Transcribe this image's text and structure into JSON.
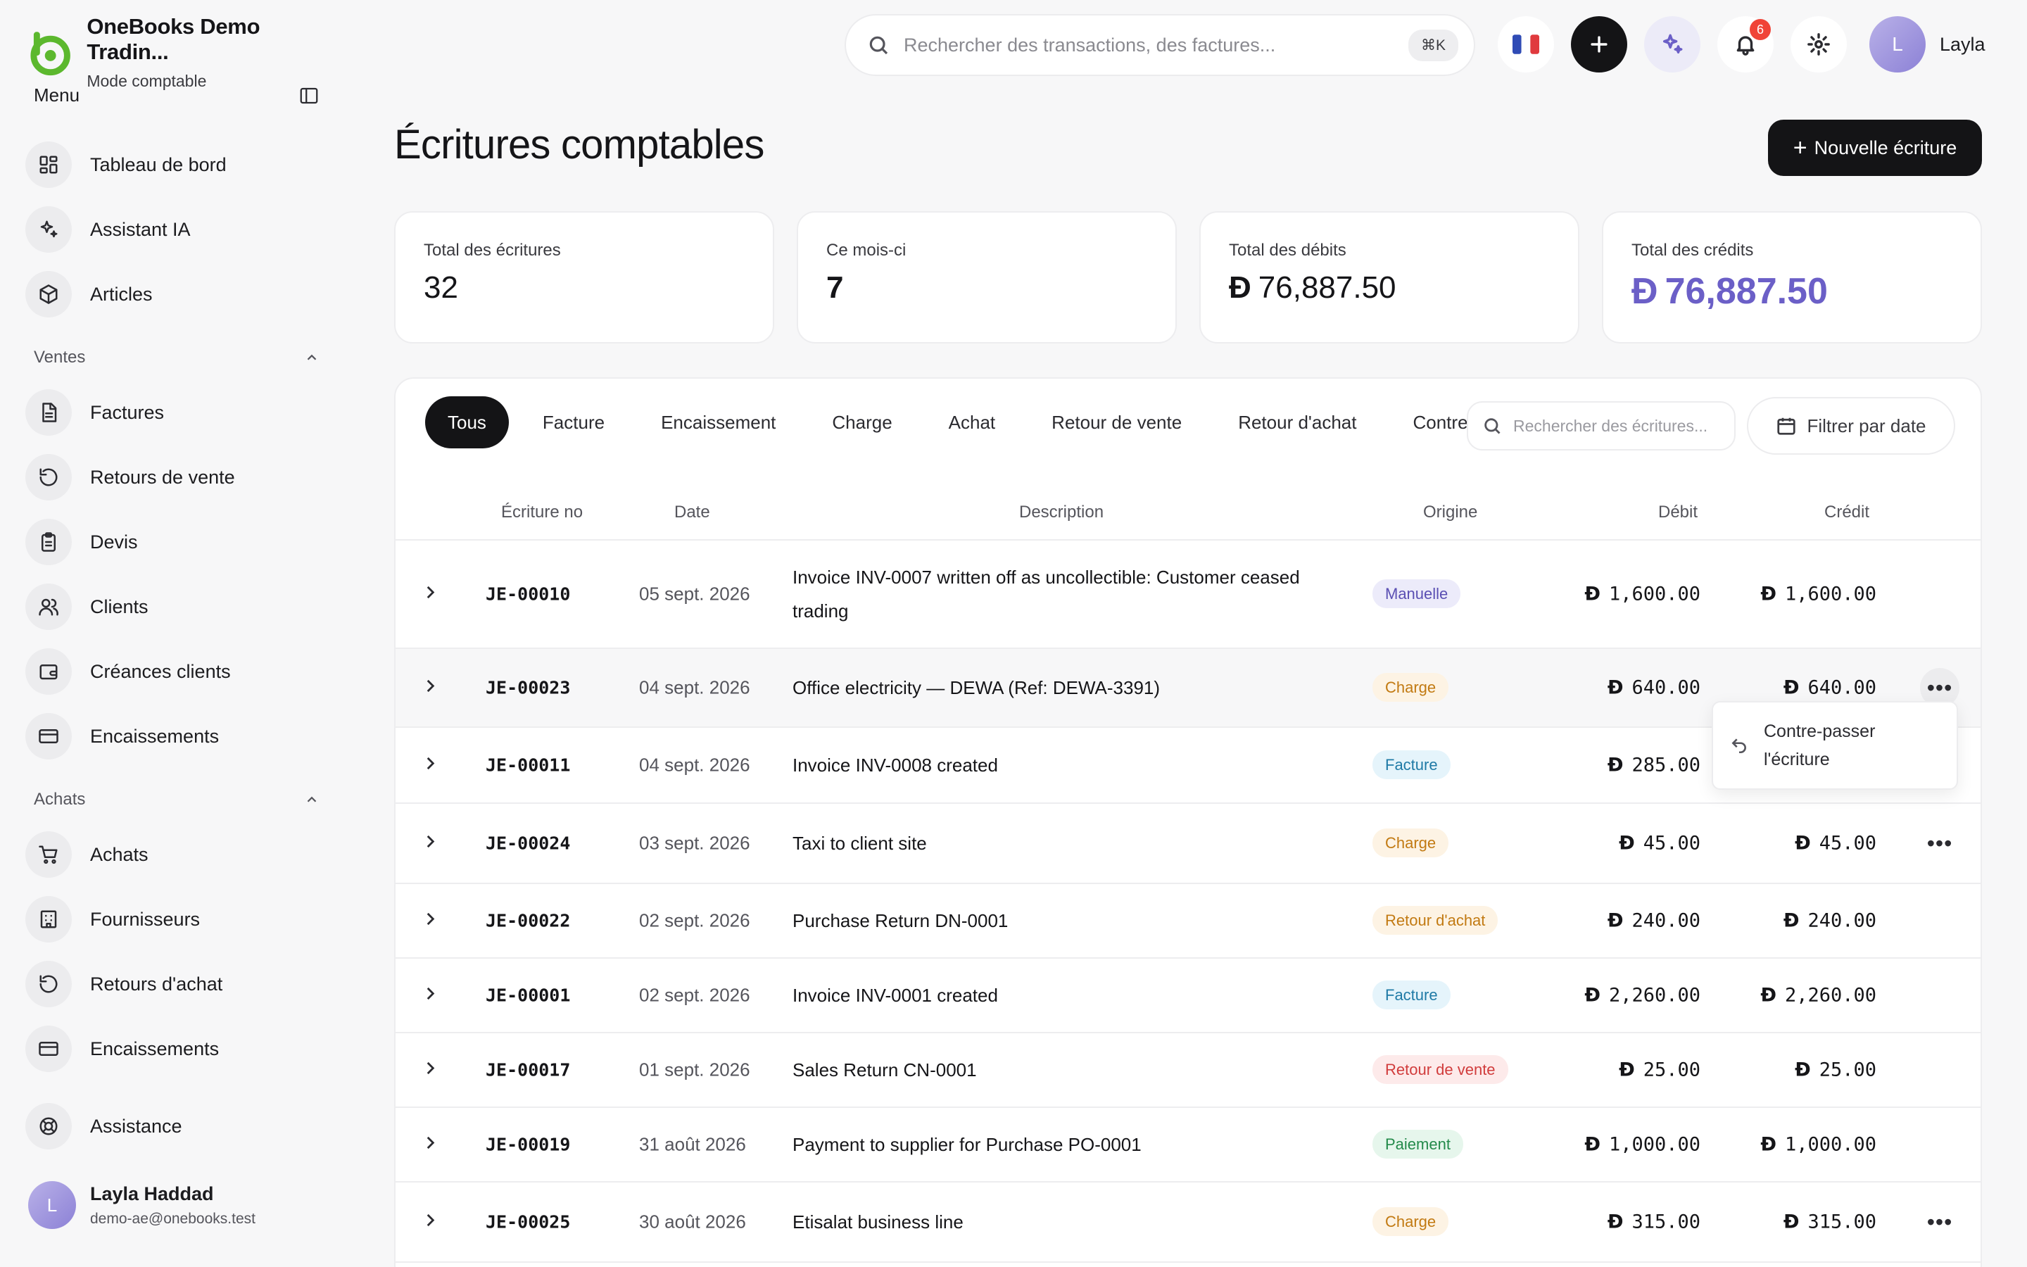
{
  "app": {
    "name": "OneBooks Demo Tradin...",
    "mode": "Mode comptable"
  },
  "sidebar": {
    "menu_label": "Menu",
    "top_items": [
      {
        "label": "Tableau de bord",
        "icon": "dashboard-icon"
      },
      {
        "label": "Assistant IA",
        "icon": "sparkles-icon"
      },
      {
        "label": "Articles",
        "icon": "box-icon"
      }
    ],
    "sales_section": "Ventes",
    "sales_items": [
      {
        "label": "Factures",
        "icon": "document-icon"
      },
      {
        "label": "Retours de vente",
        "icon": "undo-icon"
      },
      {
        "label": "Devis",
        "icon": "clipboard-icon"
      },
      {
        "label": "Clients",
        "icon": "users-icon"
      },
      {
        "label": "Créances clients",
        "icon": "wallet-icon"
      },
      {
        "label": "Encaissements",
        "icon": "card-icon"
      }
    ],
    "purchases_section": "Achats",
    "purchases_items": [
      {
        "label": "Achats",
        "icon": "cart-icon"
      },
      {
        "label": "Fournisseurs",
        "icon": "building-icon"
      },
      {
        "label": "Retours d'achat",
        "icon": "undo-icon"
      },
      {
        "label": "Encaissements",
        "icon": "card-icon"
      }
    ],
    "support": {
      "label": "Assistance",
      "icon": "lifebuoy-icon"
    },
    "user": {
      "initial": "L",
      "name": "Layla Haddad",
      "email": "demo-ae@onebooks.test"
    }
  },
  "topbar": {
    "search_placeholder": "Rechercher des transactions, des factures...",
    "shortcut": "⌘K",
    "notifications_count": "6",
    "user_initial": "L",
    "user_name": "Layla"
  },
  "page": {
    "title": "Écritures comptables",
    "new_button": "Nouvelle écriture"
  },
  "stats": [
    {
      "label": "Total des écritures",
      "value": "32"
    },
    {
      "label": "Ce mois-ci",
      "value": "7"
    },
    {
      "label": "Total des débits",
      "value": "76,887.50"
    },
    {
      "label": "Total des crédits",
      "value": "76,887.50"
    }
  ],
  "currency_symbol": "Ð",
  "filters": {
    "chips": [
      "Tous",
      "Facture",
      "Encaissement",
      "Charge",
      "Achat",
      "Retour de vente",
      "Retour d'achat",
      "Contre"
    ],
    "search_placeholder": "Rechercher des écritures...",
    "date_button": "Filtrer par date"
  },
  "table": {
    "headers": {
      "no": "Écriture no",
      "date": "Date",
      "description": "Description",
      "origin": "Origine",
      "debit": "Débit",
      "credit": "Crédit"
    },
    "rows": [
      {
        "no": "JE-00010",
        "date": "05 sept. 2026",
        "description": "Invoice INV-0007 written off as uncollectible: Customer ceased trading",
        "origin": "Manuelle",
        "origin_kind": "manuelle",
        "debit": "1,600.00",
        "credit": "1,600.00",
        "more": false
      },
      {
        "no": "JE-00023",
        "date": "04 sept. 2026",
        "description": "Office electricity — DEWA (Ref: DEWA-3391)",
        "origin": "Charge",
        "origin_kind": "charge",
        "debit": "640.00",
        "credit": "640.00",
        "more": true,
        "more_active": true
      },
      {
        "no": "JE-00011",
        "date": "04 sept. 2026",
        "description": "Invoice INV-0008 created",
        "origin": "Facture",
        "origin_kind": "facture",
        "debit": "285.00",
        "credit": "",
        "more": false
      },
      {
        "no": "JE-00024",
        "date": "03 sept. 2026",
        "description": "Taxi to client site",
        "origin": "Charge",
        "origin_kind": "charge",
        "debit": "45.00",
        "credit": "45.00",
        "more": true
      },
      {
        "no": "JE-00022",
        "date": "02 sept. 2026",
        "description": "Purchase Return DN-0001",
        "origin": "Retour d'achat",
        "origin_kind": "retour_achat",
        "debit": "240.00",
        "credit": "240.00",
        "more": false
      },
      {
        "no": "JE-00001",
        "date": "02 sept. 2026",
        "description": "Invoice INV-0001 created",
        "origin": "Facture",
        "origin_kind": "facture",
        "debit": "2,260.00",
        "credit": "2,260.00",
        "more": false
      },
      {
        "no": "JE-00017",
        "date": "01 sept. 2026",
        "description": "Sales Return CN-0001",
        "origin": "Retour de vente",
        "origin_kind": "retour_vente",
        "debit": "25.00",
        "credit": "25.00",
        "more": false
      },
      {
        "no": "JE-00019",
        "date": "31 août 2026",
        "description": "Payment to supplier for Purchase PO-0001",
        "origin": "Paiement",
        "origin_kind": "paiement",
        "debit": "1,000.00",
        "credit": "1,000.00",
        "more": false
      },
      {
        "no": "JE-00025",
        "date": "30 août 2026",
        "description": "Etisalat business line",
        "origin": "Charge",
        "origin_kind": "charge",
        "debit": "315.00",
        "credit": "315.00",
        "more": true
      }
    ]
  },
  "popover": {
    "label": "Contre-passer l'écriture"
  }
}
